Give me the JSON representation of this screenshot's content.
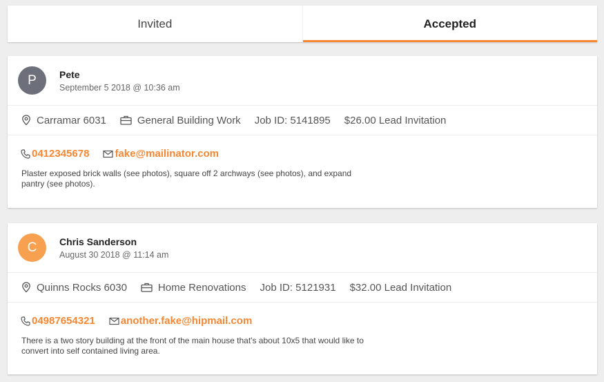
{
  "tabs": [
    {
      "label": "Invited",
      "active": false
    },
    {
      "label": "Accepted",
      "active": true
    }
  ],
  "accent_color": "#f58733",
  "leads": [
    {
      "initial": "P",
      "avatar_color": "#6d6f7a",
      "name": "Pete",
      "date": "September 5 2018 @ 10:36 am",
      "location": "Carramar 6031",
      "category": "General Building Work",
      "job_id": "Job ID: 5141895",
      "price": "$26.00 Lead Invitation",
      "phone": "0412345678",
      "email": "fake@mailinator.com",
      "description": "Plaster exposed brick walls (see photos), square off 2 archways (see photos), and expand pantry (see photos)."
    },
    {
      "initial": "C",
      "avatar_color": "#f7a04f",
      "name": "Chris Sanderson",
      "date": "August 30 2018 @ 11:14 am",
      "location": "Quinns Rocks 6030",
      "category": "Home Renovations",
      "job_id": "Job ID: 5121931",
      "price": "$32.00 Lead Invitation",
      "phone": "04987654321",
      "email": "another.fake@hipmail.com",
      "description": "There is a two story building at the front of the main house that's about 10x5 that would like to convert into self contained living area."
    }
  ]
}
